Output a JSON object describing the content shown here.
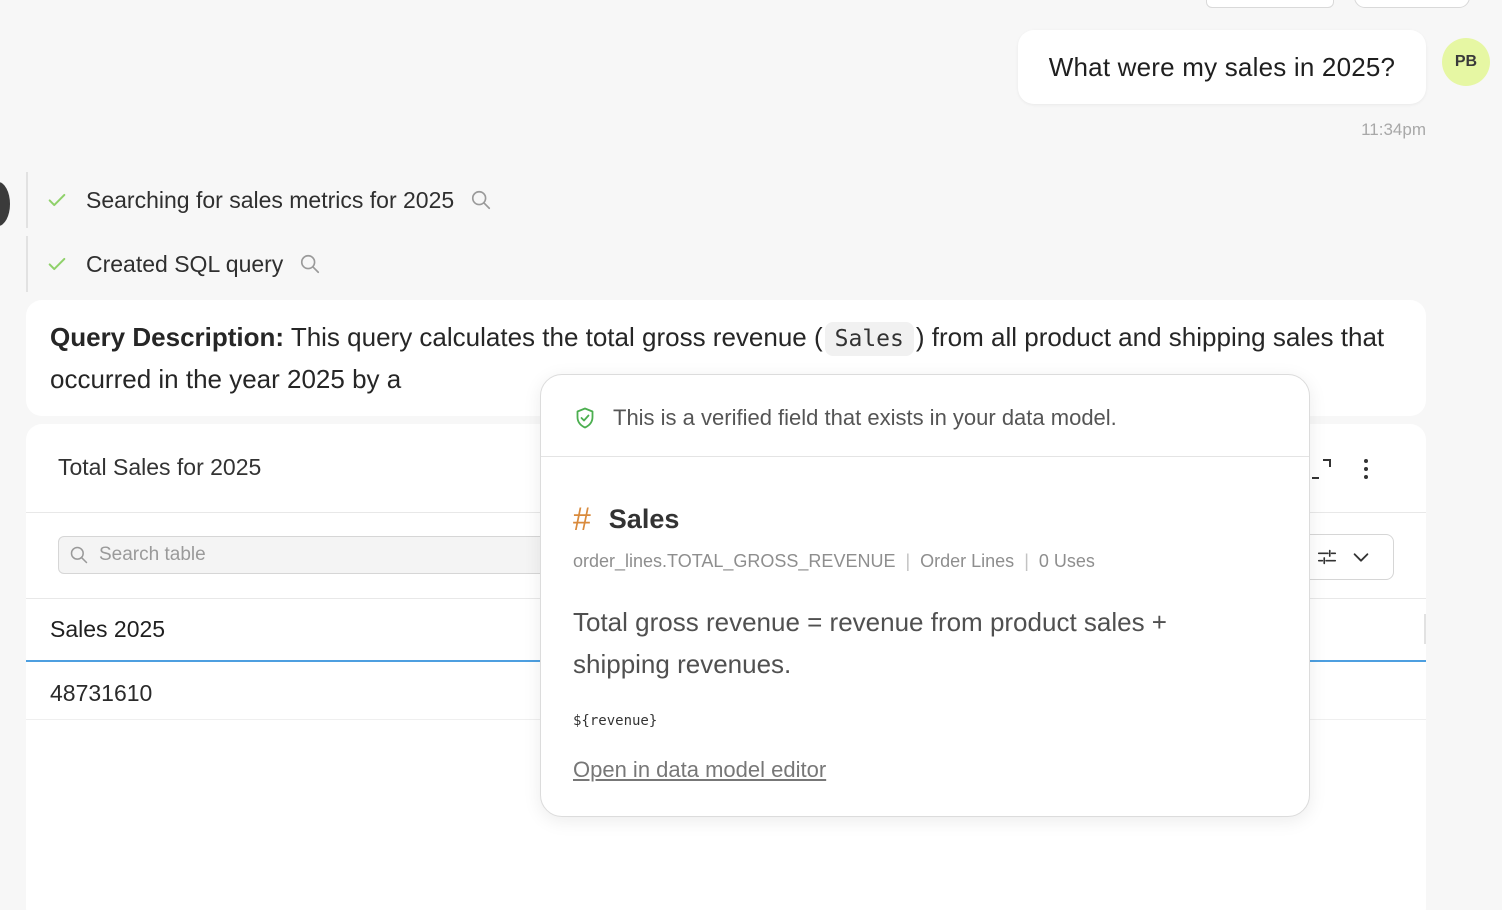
{
  "chat": {
    "user_message": "What were my sales in 2025?",
    "user_initials": "PB",
    "timestamp": "11:34pm"
  },
  "steps": [
    {
      "label": "Searching for sales metrics for 2025",
      "status": "done"
    },
    {
      "label": "Created SQL query",
      "status": "done"
    }
  ],
  "description": {
    "heading": "Query Description:",
    "text_before": " This query calculates the total gross revenue (",
    "field_chip": "Sales",
    "text_after": ") from all product and shipping sales that occurred in the year 2025 by a"
  },
  "result_table": {
    "title": "Total Sales for 2025",
    "search_placeholder": "Search table",
    "columns": [
      "Sales 2025"
    ],
    "rows": [
      [
        "48731610"
      ]
    ]
  },
  "popover": {
    "verified_text": "This is a verified field that exists in your data model.",
    "field_name": "Sales",
    "field_path": "order_lines.TOTAL_GROSS_REVENUE",
    "source": "Order Lines",
    "uses": "0 Uses",
    "description": "Total gross revenue = revenue from product sales + shipping revenues.",
    "expression": "${revenue}",
    "link_label": "Open in data model editor"
  },
  "icons": {
    "check": "check-icon",
    "magnifier": "magnifier-icon",
    "shield": "shield-check-icon",
    "hash": "hash-icon",
    "expand": "expand-icon",
    "kebab": "kebab-menu-icon",
    "settings": "sliders-icon",
    "chevron": "chevron-down-icon"
  },
  "colors": {
    "check_green": "#8fd16a",
    "avatar_bg": "#e6f7a3",
    "header_underline": "#4d9fe0",
    "hash_orange": "#d98a3c",
    "shield_green": "#4caf50"
  }
}
